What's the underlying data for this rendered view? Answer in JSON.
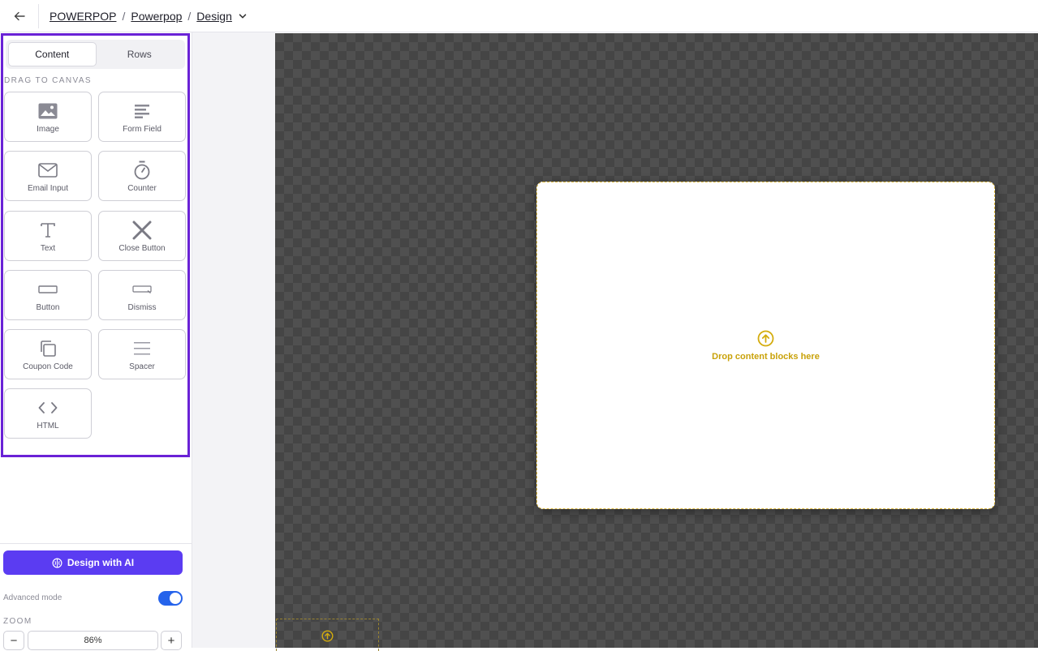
{
  "topbar": {
    "breadcrumbs": [
      "POWERPOP",
      "Powerpop",
      "Design"
    ],
    "separator": "/"
  },
  "panel": {
    "tabs": [
      "Content",
      "Rows"
    ],
    "drag_label": "DRAG TO CANVAS",
    "blocks": [
      {
        "label": "Image",
        "icon": "image-icon"
      },
      {
        "label": "Form Field",
        "icon": "form-field-icon"
      },
      {
        "label": "Email Input",
        "icon": "envelope-icon"
      },
      {
        "label": "Counter",
        "icon": "stopwatch-icon"
      },
      {
        "label": "Text",
        "icon": "text-icon"
      },
      {
        "label": "Close Button",
        "icon": "close-icon"
      },
      {
        "label": "Button",
        "icon": "button-icon"
      },
      {
        "label": "Dismiss",
        "icon": "dismiss-icon"
      },
      {
        "label": "Coupon Code",
        "icon": "copy-icon"
      },
      {
        "label": "Spacer",
        "icon": "spacer-icon"
      },
      {
        "label": "HTML",
        "icon": "code-icon"
      }
    ],
    "ai_button": "Design with AI",
    "advanced_mode": "Advanced mode",
    "advanced_mode_on": true,
    "zoom_label": "ZOOM",
    "zoom_value": "86%",
    "zoom_minus": "−",
    "zoom_plus": "+"
  },
  "canvas": {
    "drop_text": "Drop content blocks here"
  },
  "colors": {
    "accent_purple": "#5b3cf2",
    "frame_purple": "#6a22d6",
    "toggle_blue": "#2563eb",
    "drop_yellow": "#c9a20a"
  }
}
